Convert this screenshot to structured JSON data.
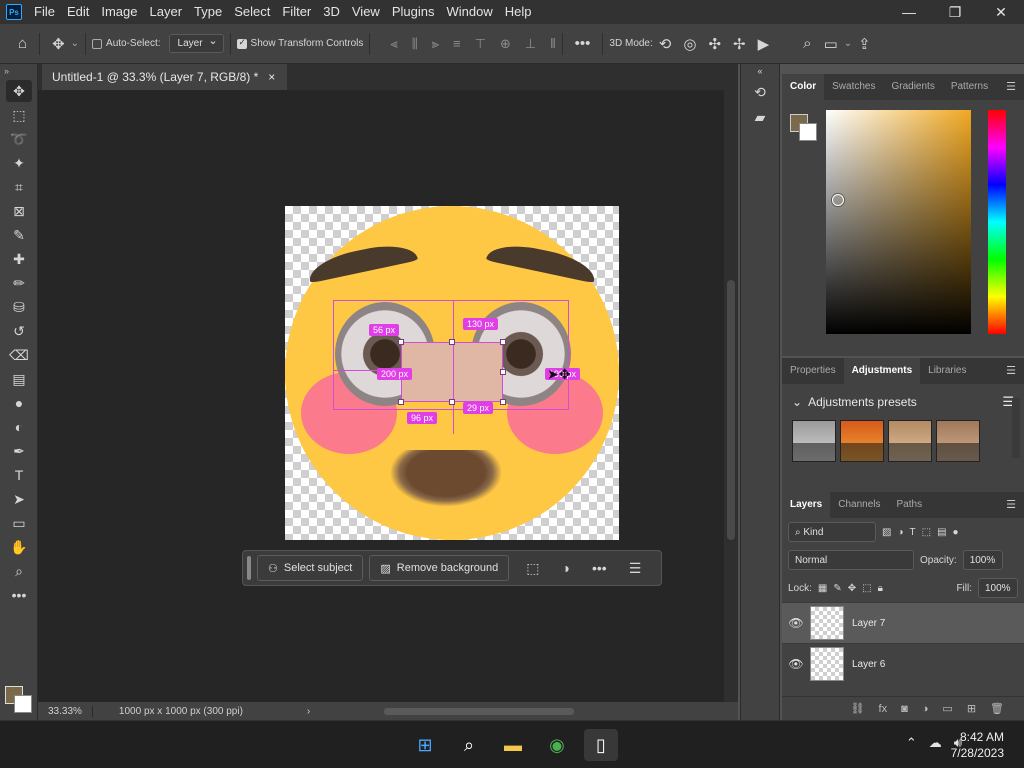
{
  "app": {
    "logo": "Ps"
  },
  "menu": [
    "File",
    "Edit",
    "Image",
    "Layer",
    "Type",
    "Select",
    "Filter",
    "3D",
    "View",
    "Plugins",
    "Window",
    "Help"
  ],
  "window_controls": [
    "—",
    "❐",
    "✕"
  ],
  "options_bar": {
    "auto_select_label": "Auto-Select:",
    "auto_select_checked": false,
    "auto_select_value": "Layer",
    "show_transform_label": "Show Transform Controls",
    "show_transform_checked": true,
    "mode_label": "3D Mode:"
  },
  "document": {
    "tab_title": "Untitled-1 @ 33.3% (Layer 7, RGB/8) *",
    "zoom": "33.33%",
    "info": "1000 px x 1000 px (300 ppi)",
    "fill_color": "#fec844",
    "cheek_color": "#fb7a8c"
  },
  "measurements": [
    "56 px",
    "130 px",
    "200 px",
    "199 px",
    "96 px",
    "29 px"
  ],
  "context_bar": {
    "select_subject": "Select subject",
    "remove_background": "Remove background"
  },
  "color_panel": {
    "tabs": [
      "Color",
      "Swatches",
      "Gradients",
      "Patterns"
    ],
    "active_tab": "Color",
    "foreground": "#7a6a4a",
    "background": "#ffffff"
  },
  "adjustments_panel": {
    "tabs": [
      "Properties",
      "Adjustments",
      "Libraries"
    ],
    "active_tab": "Adjustments",
    "section_title": "Adjustments presets"
  },
  "layers_panel": {
    "tabs": [
      "Layers",
      "Channels",
      "Paths"
    ],
    "active_tab": "Layers",
    "filter": "Kind",
    "blend_mode": "Normal",
    "opacity_label": "Opacity:",
    "opacity": "100%",
    "lock_label": "Lock:",
    "fill_label": "Fill:",
    "fill": "100%",
    "layers": [
      {
        "name": "Layer 7",
        "visible": true,
        "selected": true
      },
      {
        "name": "Layer 6",
        "visible": true,
        "selected": false
      }
    ]
  },
  "taskbar": {
    "time": "8:42 AM",
    "date": "7/28/2023"
  }
}
